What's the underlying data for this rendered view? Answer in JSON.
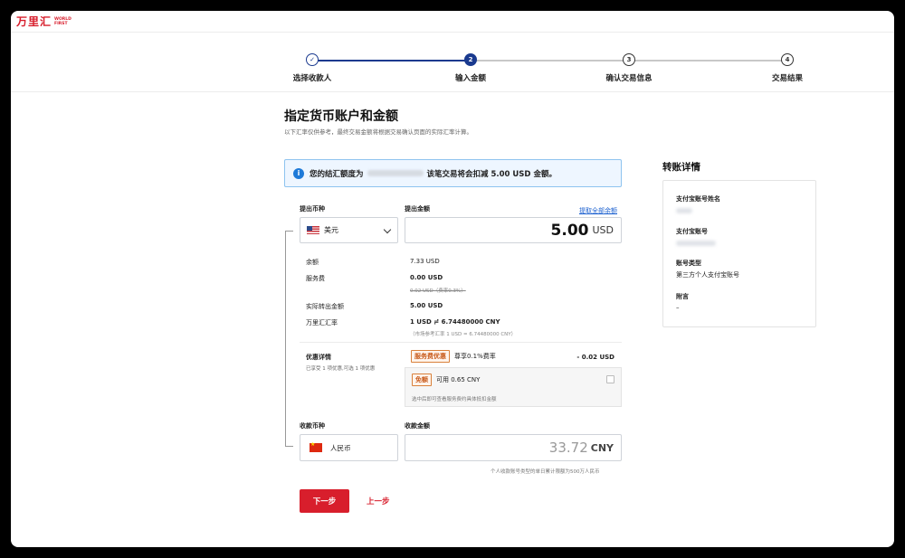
{
  "brand": {
    "cn": "万里汇",
    "en1": "WORLD",
    "en2": "FIRST"
  },
  "steps": [
    {
      "index": "✓",
      "label": "选择收款人",
      "state": "done"
    },
    {
      "index": "2",
      "label": "输入金额",
      "state": "active"
    },
    {
      "index": "3",
      "label": "确认交易信息",
      "state": "todo"
    },
    {
      "index": "4",
      "label": "交易结果",
      "state": "todo"
    }
  ],
  "page": {
    "title": "指定货币账户和金额",
    "subtitle": "以下汇率仅供参考，最终交易金额将根据交易确认页面的实际汇率计算。"
  },
  "notice": {
    "prefix": "您的结汇额度为",
    "suffix": "该笔交易将会扣减 5.00 USD 金额。"
  },
  "withdraw": {
    "currency_label": "提出币种",
    "amount_label": "提出金额",
    "all_balance_link": "提取全部余额",
    "currency": "美元",
    "amount": "5.00",
    "amount_currency": "USD"
  },
  "details": {
    "balance_label": "余额",
    "balance_value": "7.33 USD",
    "fee_label": "服务费",
    "fee_value": "0.00 USD",
    "fee_original": "0.02 USD（费率0.3%）",
    "actual_label": "实际转出金额",
    "actual_value": "5.00 USD",
    "rate_label": "万里汇汇率",
    "rate_value": "1 USD ≓ 6.74480000 CNY",
    "rate_market": "（市场参考汇率 1 USD = 6.74480000 CNY）"
  },
  "promo": {
    "label": "优惠详情",
    "sub": "已享受 1 项优惠,可选 1 项优惠",
    "tag1": "服务费优惠",
    "tag1_desc": "尊享0.1%费率",
    "tag1_amount": "- 0.02 USD",
    "tag2": "免额",
    "tag2_desc": "可用 0.65 CNY",
    "tag2_note": "选中后即可查看服务费约具体抵扣金额"
  },
  "receive": {
    "currency_label": "收款币种",
    "amount_label": "收款金额",
    "currency": "人民币",
    "amount": "33.72",
    "amount_currency": "CNY",
    "limit_note": "个人收款账号类型的单日累计限额为500万人民币"
  },
  "actions": {
    "next": "下一步",
    "prev": "上一步"
  },
  "sidebar": {
    "title": "转账详情",
    "name_label": "支付宝账号姓名",
    "account_label": "支付宝账号",
    "type_label": "账号类型",
    "type_value": "第三方个人支付宝账号",
    "note_label": "附言",
    "note_value": "–"
  }
}
